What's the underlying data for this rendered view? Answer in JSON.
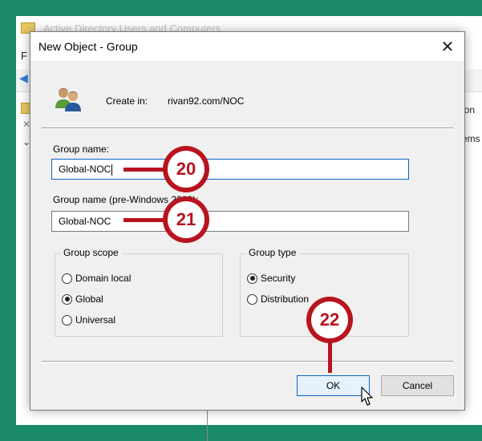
{
  "background_window": {
    "title": "Active Directory Users and Computers",
    "menu_first_letter": "F",
    "right_text_1": "ion",
    "right_text_2": "ems"
  },
  "dialog": {
    "title": "New Object - Group",
    "close_glyph": "✕",
    "create_in_label": "Create in:",
    "create_in_value": "rivan92.com/NOC",
    "group_name_label": "Group name:",
    "group_name_value": "Global-NOC",
    "group_name_pre2000_label": "Group name (pre-Windows 2000):",
    "group_name_pre2000_value": "Global-NOC",
    "group_scope": {
      "legend": "Group scope",
      "options": [
        {
          "label": "Domain local",
          "checked": false
        },
        {
          "label": "Global",
          "checked": true
        },
        {
          "label": "Universal",
          "checked": false
        }
      ]
    },
    "group_type": {
      "legend": "Group type",
      "options": [
        {
          "label": "Security",
          "checked": true
        },
        {
          "label": "Distribution",
          "checked": false
        }
      ]
    },
    "ok_label": "OK",
    "cancel_label": "Cancel"
  },
  "callouts": [
    "20",
    "21",
    "22"
  ],
  "colors": {
    "accent_border": "#0a64c8",
    "callout": "#b8141f",
    "page_background": "#1a8a6a"
  }
}
